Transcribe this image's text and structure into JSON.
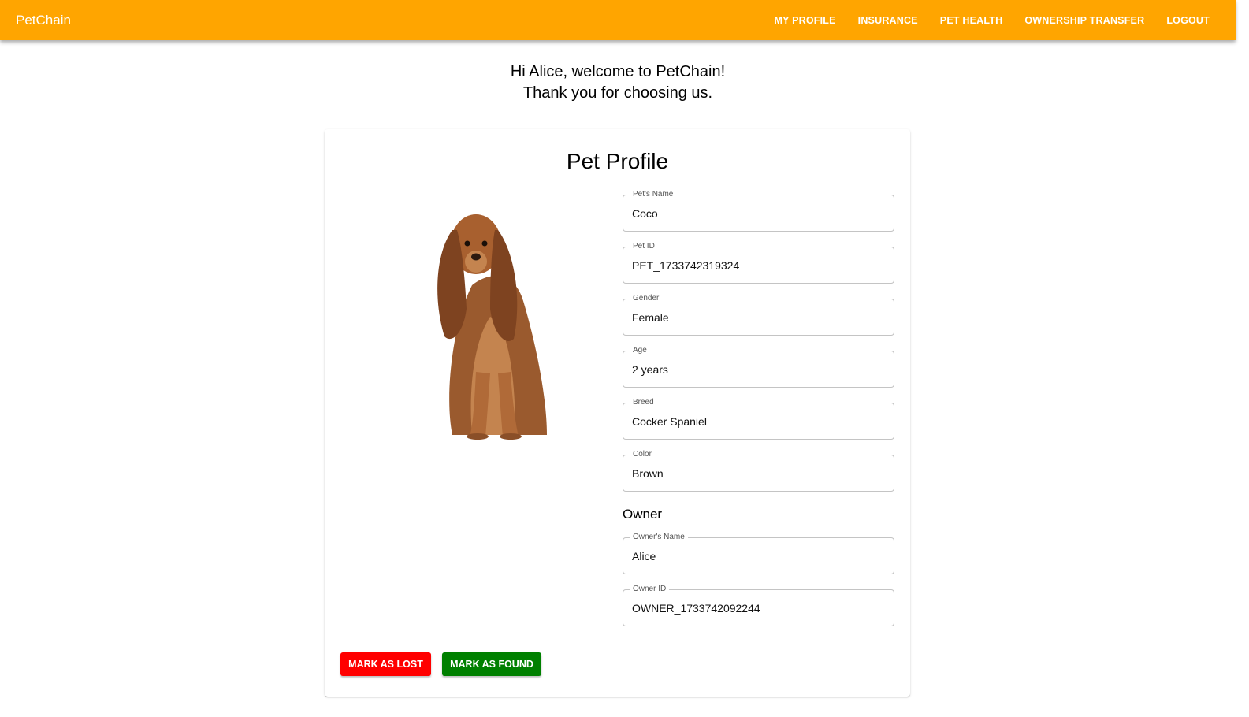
{
  "app": {
    "brand": "PetChain"
  },
  "nav": {
    "items": [
      {
        "label": "MY PROFILE"
      },
      {
        "label": "INSURANCE"
      },
      {
        "label": "PET HEALTH"
      },
      {
        "label": "OWNERSHIP TRANSFER"
      },
      {
        "label": "LOGOUT"
      }
    ]
  },
  "welcome": {
    "line1": "Hi Alice, welcome to PetChain!",
    "line2": "Thank you for choosing us."
  },
  "profile": {
    "title": "Pet Profile",
    "pet_fields": [
      {
        "label": "Pet's Name",
        "value": "Coco"
      },
      {
        "label": "Pet ID",
        "value": "PET_1733742319324"
      },
      {
        "label": "Gender",
        "value": "Female"
      },
      {
        "label": "Age",
        "value": "2 years"
      },
      {
        "label": "Breed",
        "value": "Cocker Spaniel"
      },
      {
        "label": "Color",
        "value": "Brown"
      }
    ],
    "owner_heading": "Owner",
    "owner_fields": [
      {
        "label": "Owner's Name",
        "value": "Alice"
      },
      {
        "label": "Owner ID",
        "value": "OWNER_1733742092244"
      }
    ],
    "actions": {
      "lost_label": "MARK AS LOST",
      "found_label": "MARK AS FOUND"
    }
  },
  "colors": {
    "appbar": "#ffa500",
    "lost_button": "#ff0000",
    "found_button": "#008000"
  }
}
